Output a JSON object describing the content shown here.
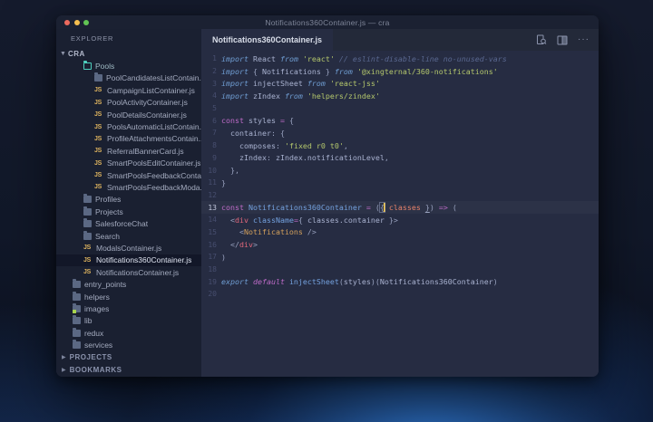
{
  "window": {
    "title": "Notifications360Container.js — cra",
    "traffic_lights": {
      "close": "#ed6a5e",
      "minimize": "#f5bf4f",
      "zoom": "#61c554"
    }
  },
  "sidebar": {
    "header": "EXPLORER",
    "root": "CRA",
    "items": [
      {
        "label": "Pools",
        "type": "folder-open-teal",
        "depth": 2,
        "selected": false
      },
      {
        "label": "PoolCandidatesListContain...",
        "type": "folder",
        "depth": 3,
        "selected": false
      },
      {
        "label": "CampaignListContainer.js",
        "type": "js",
        "depth": 3,
        "selected": false
      },
      {
        "label": "PoolActivityContainer.js",
        "type": "js",
        "depth": 3,
        "selected": false
      },
      {
        "label": "PoolDetailsContainer.js",
        "type": "js",
        "depth": 3,
        "selected": false
      },
      {
        "label": "PoolsAutomaticListContain...",
        "type": "js",
        "depth": 3,
        "selected": false
      },
      {
        "label": "ProfileAttachmentsContain...",
        "type": "js",
        "depth": 3,
        "selected": false
      },
      {
        "label": "ReferralBannerCard.js",
        "type": "js",
        "depth": 3,
        "selected": false
      },
      {
        "label": "SmartPoolsEditContainer.js",
        "type": "js",
        "depth": 3,
        "selected": false
      },
      {
        "label": "SmartPoolsFeedbackConta...",
        "type": "js",
        "depth": 3,
        "selected": false
      },
      {
        "label": "SmartPoolsFeedbackModa...",
        "type": "js",
        "depth": 3,
        "selected": false
      },
      {
        "label": "Profiles",
        "type": "folder",
        "depth": 2,
        "selected": false
      },
      {
        "label": "Projects",
        "type": "folder",
        "depth": 2,
        "selected": false
      },
      {
        "label": "SalesforceChat",
        "type": "folder",
        "depth": 2,
        "selected": false
      },
      {
        "label": "Search",
        "type": "folder",
        "depth": 2,
        "selected": false
      },
      {
        "label": "ModalsContainer.js",
        "type": "js",
        "depth": 2,
        "selected": false
      },
      {
        "label": "Notifications360Container.js",
        "type": "js",
        "depth": 2,
        "selected": true
      },
      {
        "label": "NotificationsContainer.js",
        "type": "js",
        "depth": 2,
        "selected": false
      },
      {
        "label": "entry_points",
        "type": "folder",
        "depth": 1,
        "selected": false
      },
      {
        "label": "helpers",
        "type": "folder",
        "depth": 1,
        "selected": false
      },
      {
        "label": "images",
        "type": "folder-image",
        "depth": 1,
        "selected": false
      },
      {
        "label": "lib",
        "type": "folder",
        "depth": 1,
        "selected": false
      },
      {
        "label": "redux",
        "type": "folder",
        "depth": 1,
        "selected": false
      },
      {
        "label": "services",
        "type": "folder",
        "depth": 1,
        "selected": false
      }
    ],
    "sections": [
      {
        "label": "PROJECTS"
      },
      {
        "label": "BOOKMARKS"
      }
    ]
  },
  "editor": {
    "tab": {
      "title": "Notifications360Container.js"
    },
    "actions": {
      "preview_icon": "open-preview",
      "split_icon": "split-editor",
      "more_icon": "more-actions",
      "more_glyph": "···"
    },
    "active_line": 13,
    "accent_colors": {
      "keyword_blue": "#6f9dd2",
      "keyword_magenta": "#bd6bc7",
      "string_green": "#b4c76c",
      "jsx_tag_red": "#e2687b",
      "component_orange": "#d3a05c",
      "param_orange": "#e8826a",
      "function_blue": "#74a1de",
      "comment_grey": "#5a6890",
      "cursor_yellow": "#f5c842"
    },
    "lines": [
      {
        "n": "1",
        "tokens": [
          [
            "kw",
            "import "
          ],
          [
            "id",
            "React "
          ],
          [
            "kw",
            "from "
          ],
          [
            "str",
            "'react' "
          ],
          [
            "com",
            "// eslint-disable-line no-unused-vars"
          ]
        ]
      },
      {
        "n": "2",
        "tokens": [
          [
            "kw",
            "import "
          ],
          [
            "pun",
            "{ "
          ],
          [
            "id",
            "Notifications "
          ],
          [
            "pun",
            "} "
          ],
          [
            "kw",
            "from "
          ],
          [
            "str",
            "'@xingternal/360-notifications'"
          ]
        ]
      },
      {
        "n": "3",
        "tokens": [
          [
            "kw",
            "import "
          ],
          [
            "id",
            "injectSheet "
          ],
          [
            "kw",
            "from "
          ],
          [
            "str",
            "'react-jss'"
          ]
        ]
      },
      {
        "n": "4",
        "tokens": [
          [
            "kw",
            "import "
          ],
          [
            "id",
            "zIndex "
          ],
          [
            "kw",
            "from "
          ],
          [
            "str",
            "'helpers/zindex'"
          ]
        ]
      },
      {
        "n": "5",
        "tokens": []
      },
      {
        "n": "6",
        "tokens": [
          [
            "kwm",
            "const "
          ],
          [
            "id",
            "styles "
          ],
          [
            "op",
            "= "
          ],
          [
            "pun",
            "{"
          ]
        ]
      },
      {
        "n": "7",
        "tokens": [
          [
            "id",
            "  container"
          ],
          [
            "pun",
            ": {"
          ]
        ]
      },
      {
        "n": "8",
        "tokens": [
          [
            "id",
            "    composes"
          ],
          [
            "pun",
            ": "
          ],
          [
            "str",
            "'fixed r0 t0'"
          ],
          [
            "pun",
            ","
          ]
        ]
      },
      {
        "n": "9",
        "tokens": [
          [
            "id",
            "    zIndex"
          ],
          [
            "pun",
            ": "
          ],
          [
            "id",
            "zIndex.notificationLevel"
          ],
          [
            "pun",
            ","
          ]
        ]
      },
      {
        "n": "10",
        "tokens": [
          [
            "pun",
            "  },"
          ]
        ]
      },
      {
        "n": "11",
        "tokens": [
          [
            "pun",
            "}"
          ]
        ]
      },
      {
        "n": "12",
        "tokens": []
      },
      {
        "n": "13",
        "tokens": [
          [
            "kwm",
            "const "
          ],
          [
            "def",
            "Notifications360Container "
          ],
          [
            "op",
            "= "
          ],
          [
            "pun",
            "("
          ],
          [
            "brko",
            "{"
          ],
          [
            "cursor",
            ""
          ],
          [
            "param",
            " classes "
          ],
          [
            "brkc",
            "}"
          ],
          [
            "pun",
            ") "
          ],
          [
            "op",
            "=> "
          ],
          [
            "pun",
            "("
          ]
        ]
      },
      {
        "n": "14",
        "tokens": [
          [
            "pun",
            "  <"
          ],
          [
            "tag",
            "div "
          ],
          [
            "attr",
            "className"
          ],
          [
            "op",
            "="
          ],
          [
            "pun",
            "{"
          ],
          [
            "id",
            " classes.container "
          ],
          [
            "pun",
            "}>"
          ]
        ]
      },
      {
        "n": "15",
        "tokens": [
          [
            "pun",
            "    <"
          ],
          [
            "comp",
            "Notifications "
          ],
          [
            "pun",
            "/>"
          ]
        ]
      },
      {
        "n": "16",
        "tokens": [
          [
            "pun",
            "  </"
          ],
          [
            "tag",
            "div"
          ],
          [
            "pun",
            ">"
          ]
        ]
      },
      {
        "n": "17",
        "tokens": [
          [
            "pun",
            ")"
          ]
        ]
      },
      {
        "n": "18",
        "tokens": []
      },
      {
        "n": "19",
        "tokens": [
          [
            "kw",
            "export "
          ],
          [
            "kwmi",
            "default "
          ],
          [
            "fn",
            "injectSheet"
          ],
          [
            "pun",
            "("
          ],
          [
            "id",
            "styles"
          ],
          [
            "pun",
            ")("
          ],
          [
            "id",
            "Notifications360Container"
          ],
          [
            "pun",
            ")"
          ]
        ]
      },
      {
        "n": "20",
        "tokens": []
      }
    ]
  }
}
